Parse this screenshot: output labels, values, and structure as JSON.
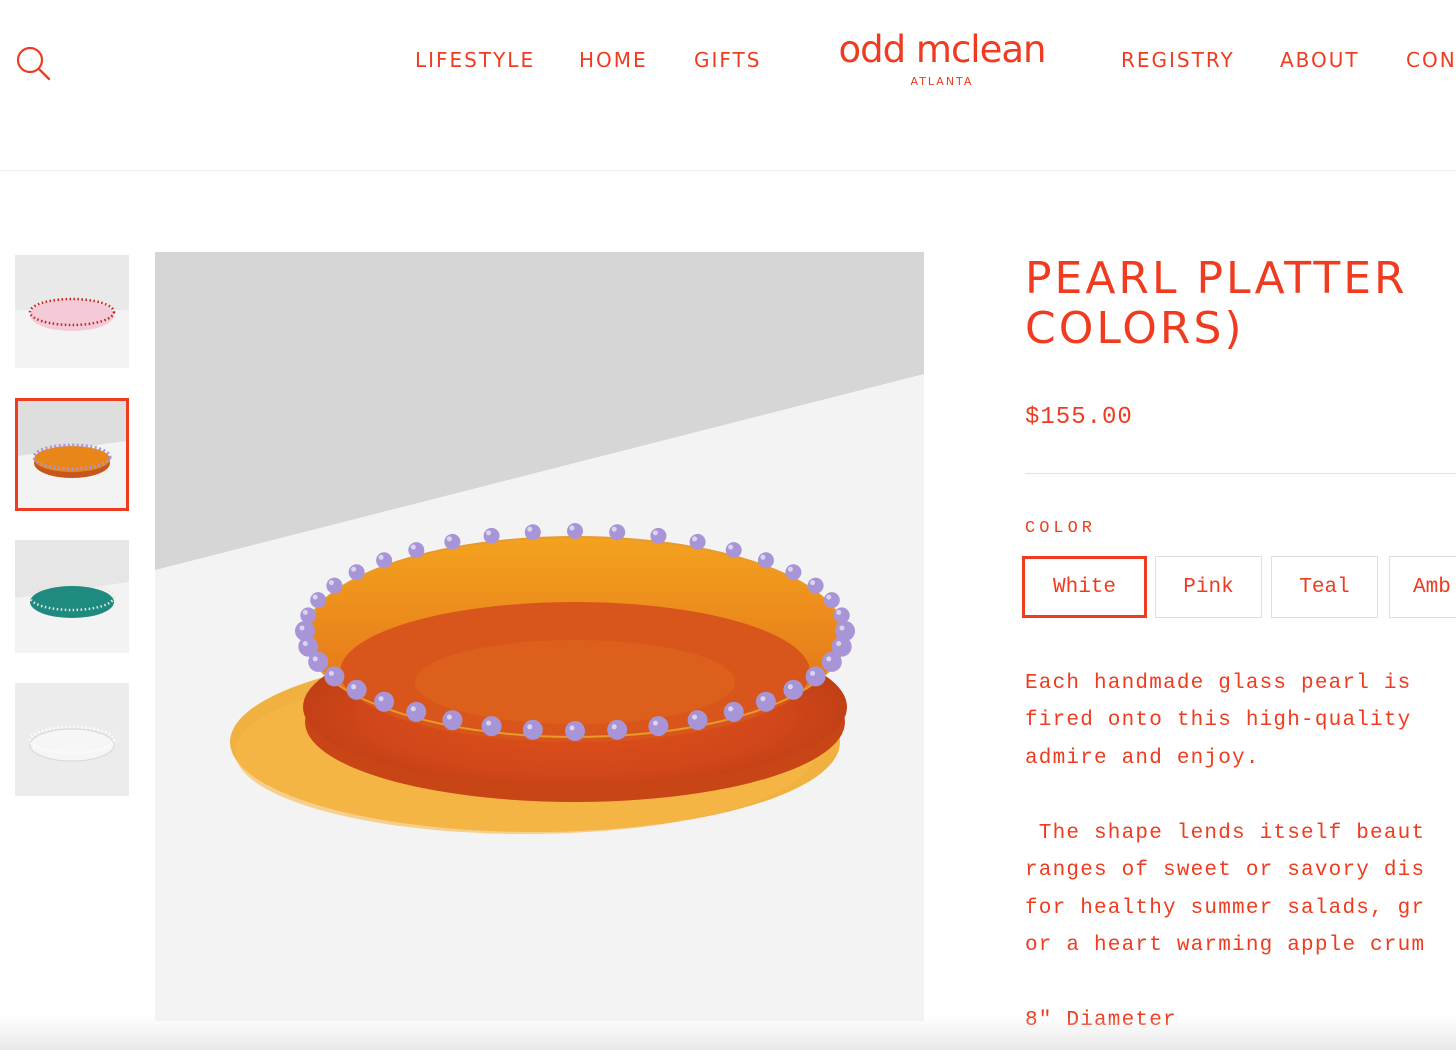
{
  "header": {
    "search_icon": "search-icon",
    "nav_left": [
      "LIFESTYLE",
      "HOME",
      "GIFTS"
    ],
    "logo_name": "odd mclean",
    "logo_sub": "ATLANTA",
    "nav_right": [
      "REGISTRY",
      "ABOUT",
      "CON"
    ]
  },
  "gallery": {
    "thumbnails": [
      {
        "name": "pink-platter-thumbnail",
        "bowl": "#f4c9d8",
        "beads": "#c0261a"
      },
      {
        "name": "amber-platter-thumbnail",
        "bowl": "#e8861a",
        "beads": "#a895d8"
      },
      {
        "name": "teal-platter-thumbnail",
        "bowl": "#1f8a80",
        "beads": "#e9e4d8"
      },
      {
        "name": "clear-platter-thumbnail",
        "bowl": "#f2f2f2",
        "beads": "#ffffff"
      }
    ],
    "active_index": 1
  },
  "product": {
    "title_line1": "PEARL PLATTER",
    "title_line2": "COLORS)",
    "price": "$155.00",
    "color_label": "COLOR",
    "color_options": [
      "White",
      "Pink",
      "Teal",
      "Amb"
    ],
    "selected_color": "White",
    "description": [
      "Each handmade glass pearl is",
      "fired onto this high-quality",
      "admire and enjoy.",
      "",
      " The shape lends itself beaut",
      "ranges of sweet or savory dis",
      "for healthy summer salads, gr",
      "or a heart warming apple crum",
      "",
      "8\" Diameter"
    ]
  },
  "colors": {
    "accent": "#ef3b1f",
    "amber": "#e8861a",
    "lilac_bead": "#a895d8"
  }
}
